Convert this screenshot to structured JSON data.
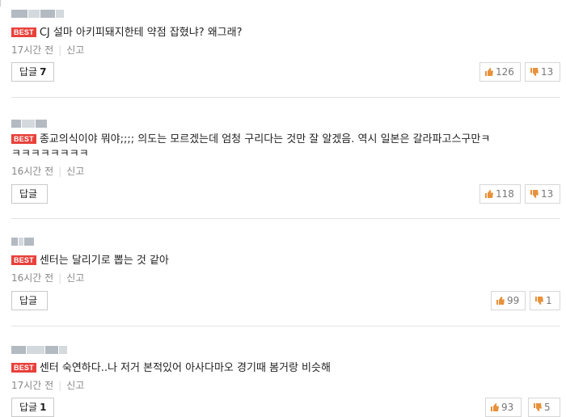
{
  "best_label": "BEST",
  "reply_label": "답글",
  "report_label": "신고",
  "comments": [
    {
      "text": "CJ 설마 아키피돼지한테 약점 잡혔냐? 왜그래?",
      "text2": "",
      "time": "17시간 전",
      "reply_count": "7",
      "likes": "126",
      "dislikes": "13"
    },
    {
      "text": "종교의식이야 뭐야;;;; 의도는 모르겠는데 엄청 구리다는 것만 잘 알겠음. 역시 일본은 갈라파고스구만ㅋ",
      "text2": "ㅋㅋㅋㅋㅋㅋㅋㅋ",
      "time": "16시간 전",
      "reply_count": "",
      "likes": "118",
      "dislikes": "13"
    },
    {
      "text": "센터는 달리기로 뽑는 것 같아",
      "text2": "",
      "time": "16시간 전",
      "reply_count": "",
      "likes": "99",
      "dislikes": "1"
    },
    {
      "text": "센터 숙연하다..나 저거 본적있어 아사다마오 경기때 봄거랑 비슷해",
      "text2": "",
      "time": "17시간 전",
      "reply_count": "1",
      "likes": "93",
      "dislikes": "5"
    }
  ],
  "colors": {
    "best_badge": "#e8413b",
    "thumb_up": "#e8913b",
    "thumb_down": "#e8913b"
  }
}
